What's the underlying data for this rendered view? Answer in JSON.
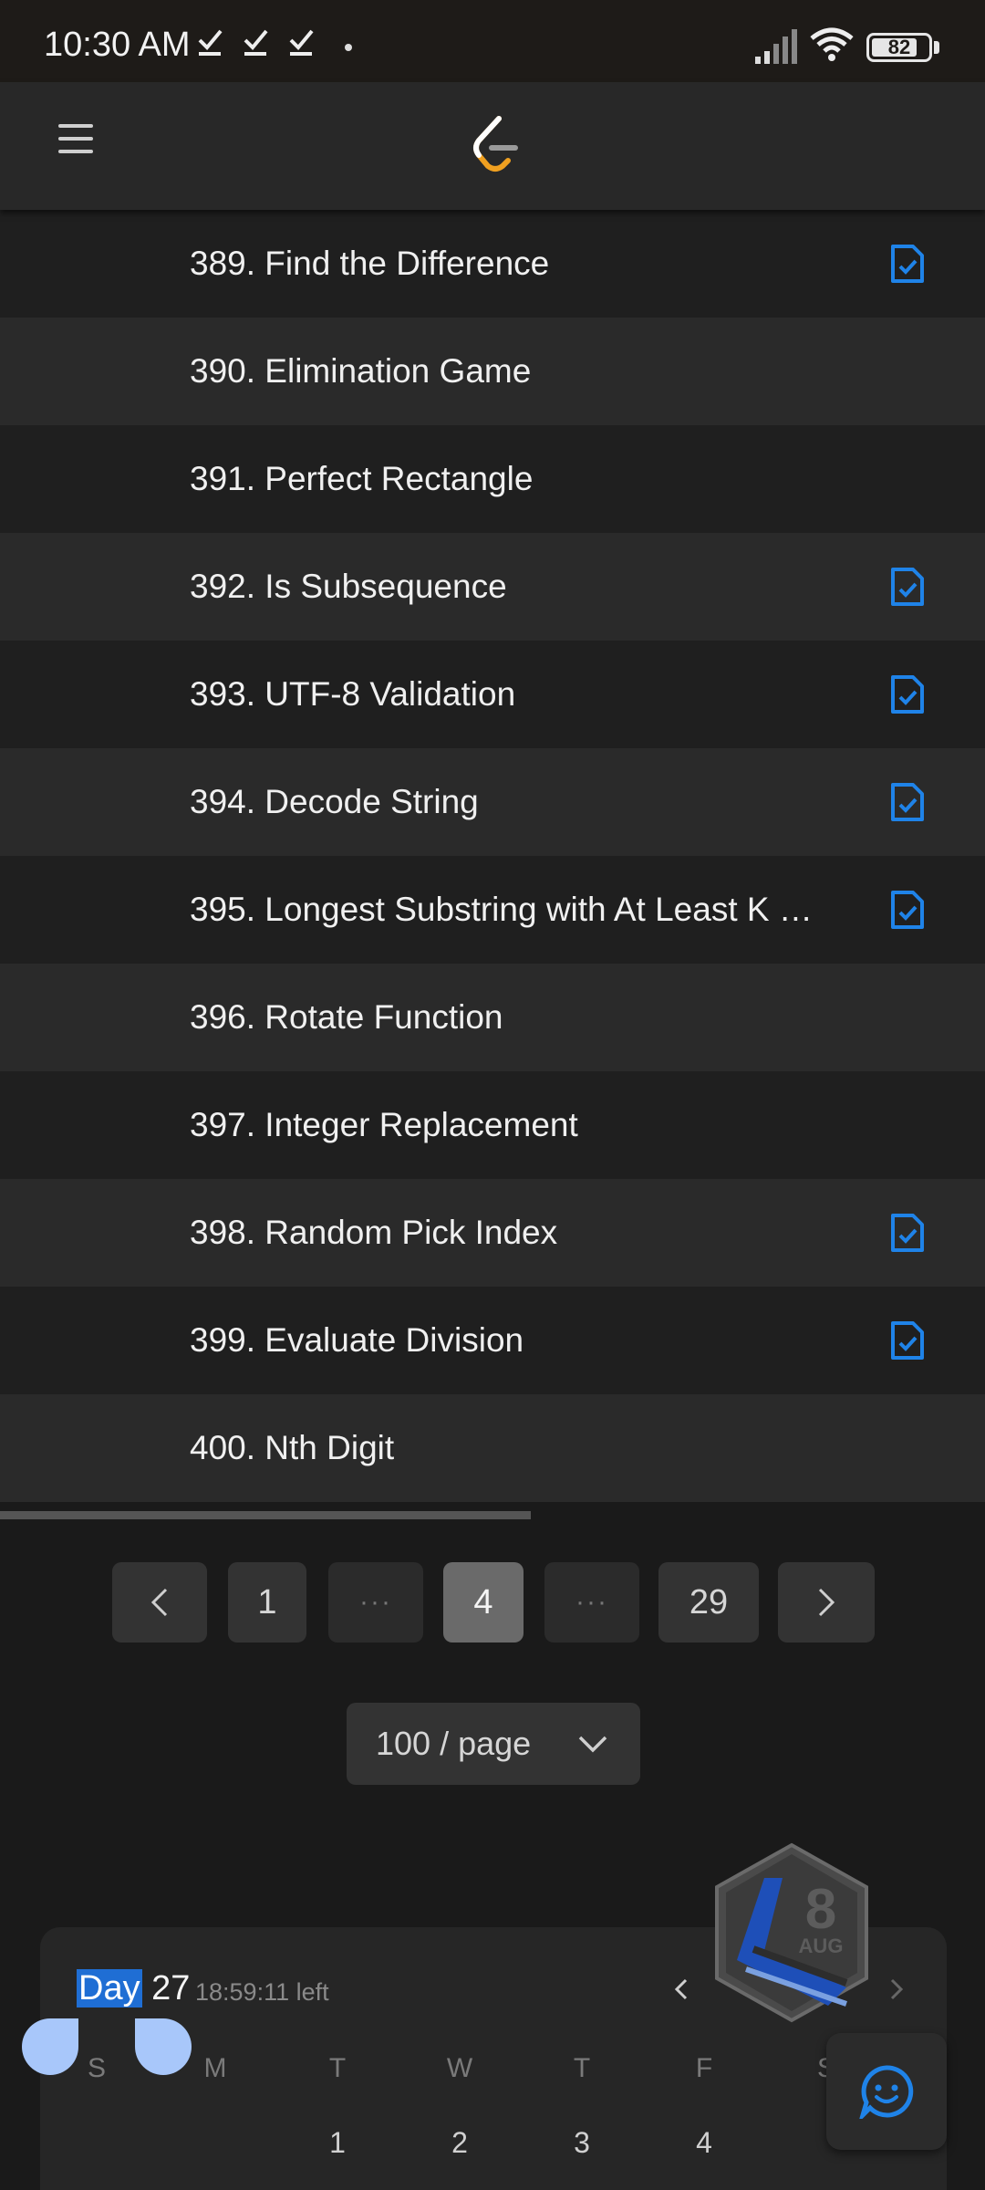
{
  "status_bar": {
    "time": "10:30 AM",
    "battery": "82",
    "battery_level": 0.82,
    "icons": [
      "check-download-icon",
      "check-download-icon",
      "check-download-icon",
      "dot-icon",
      "signal-icon",
      "wifi-icon",
      "battery-icon"
    ]
  },
  "header": {
    "menu_icon": "hamburger-icon",
    "logo_icon": "leetcode-logo-icon"
  },
  "problems": [
    {
      "title": "389. Find the Difference",
      "solution": true
    },
    {
      "title": "390. Elimination Game",
      "solution": false
    },
    {
      "title": "391. Perfect Rectangle",
      "solution": false
    },
    {
      "title": "392. Is Subsequence",
      "solution": true
    },
    {
      "title": "393. UTF-8 Validation",
      "solution": true
    },
    {
      "title": "394. Decode String",
      "solution": true
    },
    {
      "title": "395. Longest Substring with At Least K …",
      "solution": true
    },
    {
      "title": "396. Rotate Function",
      "solution": false
    },
    {
      "title": "397. Integer Replacement",
      "solution": false
    },
    {
      "title": "398. Random Pick Index",
      "solution": true
    },
    {
      "title": "399. Evaluate Division",
      "solution": true
    },
    {
      "title": "400. Nth Digit",
      "solution": false
    }
  ],
  "pagination": {
    "first": "1",
    "ellipsis": "···",
    "current": "4",
    "last": "29"
  },
  "page_size": {
    "label": "100 / page"
  },
  "calendar": {
    "day_word": "Day",
    "day_number": "27",
    "time_left": "18:59:11 left",
    "weekdays": [
      "S",
      "M",
      "T",
      "W",
      "T",
      "F",
      "S"
    ],
    "dates": [
      "1",
      "2",
      "3",
      "4"
    ],
    "badge_number": "8",
    "badge_month": "AUG"
  },
  "colors": {
    "accent_blue": "#1f83e8",
    "logo_orange": "#f0a020",
    "background": "#1a1a1a"
  }
}
